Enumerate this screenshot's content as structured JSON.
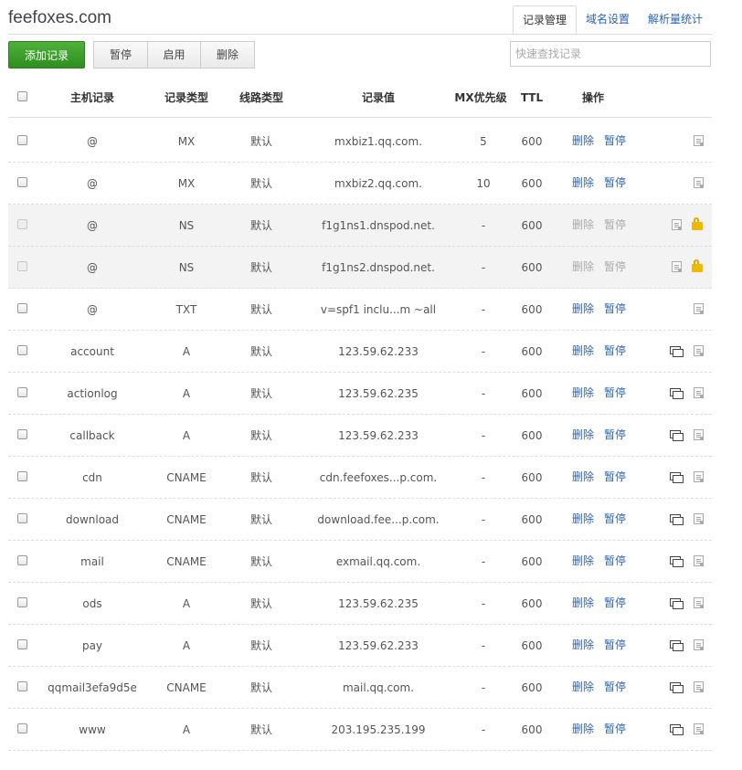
{
  "header": {
    "domain": "feefoxes.com",
    "tabs": [
      {
        "label": "记录管理",
        "active": true
      },
      {
        "label": "域名设置",
        "active": false
      },
      {
        "label": "解析量统计",
        "active": false
      }
    ]
  },
  "toolbar": {
    "add_label": "添加记录",
    "pause_label": "暂停",
    "enable_label": "启用",
    "delete_label": "删除",
    "search_placeholder": "快速查找记录"
  },
  "table": {
    "columns": [
      "主机记录",
      "记录类型",
      "线路类型",
      "记录值",
      "MX优先级",
      "TTL",
      "操作"
    ],
    "delete_label": "删除",
    "pause_label": "暂停",
    "rows": [
      {
        "host": "@",
        "type": "MX",
        "line": "默认",
        "value": "mxbiz1.qq.com.",
        "mx": "5",
        "ttl": "600",
        "locked": false,
        "remark": false
      },
      {
        "host": "@",
        "type": "MX",
        "line": "默认",
        "value": "mxbiz2.qq.com.",
        "mx": "10",
        "ttl": "600",
        "locked": false,
        "remark": false
      },
      {
        "host": "@",
        "type": "NS",
        "line": "默认",
        "value": "f1g1ns1.dnspod.net.",
        "mx": "-",
        "ttl": "600",
        "locked": true,
        "remark": false
      },
      {
        "host": "@",
        "type": "NS",
        "line": "默认",
        "value": "f1g1ns2.dnspod.net.",
        "mx": "-",
        "ttl": "600",
        "locked": true,
        "remark": false
      },
      {
        "host": "@",
        "type": "TXT",
        "line": "默认",
        "value": "v=spf1 inclu...m ~all",
        "mx": "-",
        "ttl": "600",
        "locked": false,
        "remark": false
      },
      {
        "host": "account",
        "type": "A",
        "line": "默认",
        "value": "123.59.62.233",
        "mx": "-",
        "ttl": "600",
        "locked": false,
        "remark": true
      },
      {
        "host": "actionlog",
        "type": "A",
        "line": "默认",
        "value": "123.59.62.235",
        "mx": "-",
        "ttl": "600",
        "locked": false,
        "remark": true
      },
      {
        "host": "callback",
        "type": "A",
        "line": "默认",
        "value": "123.59.62.233",
        "mx": "-",
        "ttl": "600",
        "locked": false,
        "remark": true
      },
      {
        "host": "cdn",
        "type": "CNAME",
        "line": "默认",
        "value": "cdn.feefoxes...p.com.",
        "mx": "-",
        "ttl": "600",
        "locked": false,
        "remark": true
      },
      {
        "host": "download",
        "type": "CNAME",
        "line": "默认",
        "value": "download.fee...p.com.",
        "mx": "-",
        "ttl": "600",
        "locked": false,
        "remark": true
      },
      {
        "host": "mail",
        "type": "CNAME",
        "line": "默认",
        "value": "exmail.qq.com.",
        "mx": "-",
        "ttl": "600",
        "locked": false,
        "remark": true
      },
      {
        "host": "ods",
        "type": "A",
        "line": "默认",
        "value": "123.59.62.235",
        "mx": "-",
        "ttl": "600",
        "locked": false,
        "remark": true
      },
      {
        "host": "pay",
        "type": "A",
        "line": "默认",
        "value": "123.59.62.233",
        "mx": "-",
        "ttl": "600",
        "locked": false,
        "remark": true
      },
      {
        "host": "qqmail3efa9d5e",
        "type": "CNAME",
        "line": "默认",
        "value": "mail.qq.com.",
        "mx": "-",
        "ttl": "600",
        "locked": false,
        "remark": true
      },
      {
        "host": "www",
        "type": "A",
        "line": "默认",
        "value": "203.195.235.199",
        "mx": "-",
        "ttl": "600",
        "locked": false,
        "remark": true
      }
    ]
  },
  "colors": {
    "accent": "#2d64b3",
    "add_button": "#3a9c29",
    "lock": "#f0b800"
  },
  "icons": {
    "remark": "remark-bubble-icon",
    "note": "note-icon",
    "lock": "lock-icon"
  }
}
